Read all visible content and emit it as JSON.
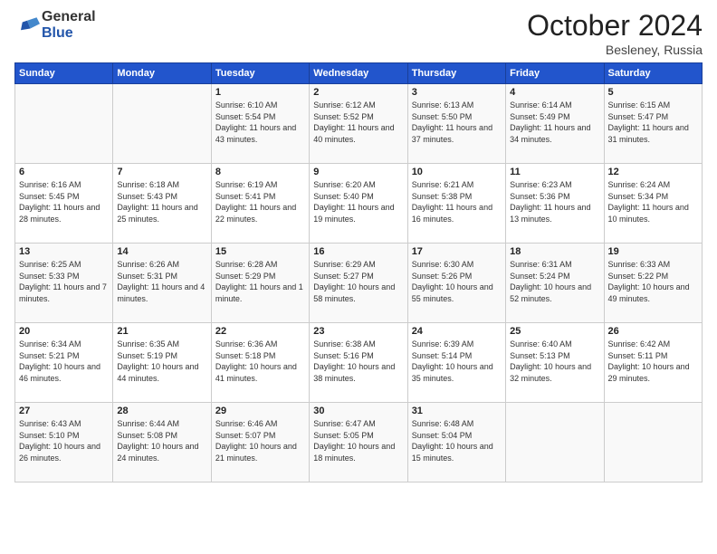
{
  "header": {
    "logo_general": "General",
    "logo_blue": "Blue",
    "month": "October 2024",
    "location": "Besleney, Russia"
  },
  "days_of_week": [
    "Sunday",
    "Monday",
    "Tuesday",
    "Wednesday",
    "Thursday",
    "Friday",
    "Saturday"
  ],
  "weeks": [
    [
      {
        "day": "",
        "sunrise": "",
        "sunset": "",
        "daylight": ""
      },
      {
        "day": "",
        "sunrise": "",
        "sunset": "",
        "daylight": ""
      },
      {
        "day": "1",
        "sunrise": "Sunrise: 6:10 AM",
        "sunset": "Sunset: 5:54 PM",
        "daylight": "Daylight: 11 hours and 43 minutes."
      },
      {
        "day": "2",
        "sunrise": "Sunrise: 6:12 AM",
        "sunset": "Sunset: 5:52 PM",
        "daylight": "Daylight: 11 hours and 40 minutes."
      },
      {
        "day": "3",
        "sunrise": "Sunrise: 6:13 AM",
        "sunset": "Sunset: 5:50 PM",
        "daylight": "Daylight: 11 hours and 37 minutes."
      },
      {
        "day": "4",
        "sunrise": "Sunrise: 6:14 AM",
        "sunset": "Sunset: 5:49 PM",
        "daylight": "Daylight: 11 hours and 34 minutes."
      },
      {
        "day": "5",
        "sunrise": "Sunrise: 6:15 AM",
        "sunset": "Sunset: 5:47 PM",
        "daylight": "Daylight: 11 hours and 31 minutes."
      }
    ],
    [
      {
        "day": "6",
        "sunrise": "Sunrise: 6:16 AM",
        "sunset": "Sunset: 5:45 PM",
        "daylight": "Daylight: 11 hours and 28 minutes."
      },
      {
        "day": "7",
        "sunrise": "Sunrise: 6:18 AM",
        "sunset": "Sunset: 5:43 PM",
        "daylight": "Daylight: 11 hours and 25 minutes."
      },
      {
        "day": "8",
        "sunrise": "Sunrise: 6:19 AM",
        "sunset": "Sunset: 5:41 PM",
        "daylight": "Daylight: 11 hours and 22 minutes."
      },
      {
        "day": "9",
        "sunrise": "Sunrise: 6:20 AM",
        "sunset": "Sunset: 5:40 PM",
        "daylight": "Daylight: 11 hours and 19 minutes."
      },
      {
        "day": "10",
        "sunrise": "Sunrise: 6:21 AM",
        "sunset": "Sunset: 5:38 PM",
        "daylight": "Daylight: 11 hours and 16 minutes."
      },
      {
        "day": "11",
        "sunrise": "Sunrise: 6:23 AM",
        "sunset": "Sunset: 5:36 PM",
        "daylight": "Daylight: 11 hours and 13 minutes."
      },
      {
        "day": "12",
        "sunrise": "Sunrise: 6:24 AM",
        "sunset": "Sunset: 5:34 PM",
        "daylight": "Daylight: 11 hours and 10 minutes."
      }
    ],
    [
      {
        "day": "13",
        "sunrise": "Sunrise: 6:25 AM",
        "sunset": "Sunset: 5:33 PM",
        "daylight": "Daylight: 11 hours and 7 minutes."
      },
      {
        "day": "14",
        "sunrise": "Sunrise: 6:26 AM",
        "sunset": "Sunset: 5:31 PM",
        "daylight": "Daylight: 11 hours and 4 minutes."
      },
      {
        "day": "15",
        "sunrise": "Sunrise: 6:28 AM",
        "sunset": "Sunset: 5:29 PM",
        "daylight": "Daylight: 11 hours and 1 minute."
      },
      {
        "day": "16",
        "sunrise": "Sunrise: 6:29 AM",
        "sunset": "Sunset: 5:27 PM",
        "daylight": "Daylight: 10 hours and 58 minutes."
      },
      {
        "day": "17",
        "sunrise": "Sunrise: 6:30 AM",
        "sunset": "Sunset: 5:26 PM",
        "daylight": "Daylight: 10 hours and 55 minutes."
      },
      {
        "day": "18",
        "sunrise": "Sunrise: 6:31 AM",
        "sunset": "Sunset: 5:24 PM",
        "daylight": "Daylight: 10 hours and 52 minutes."
      },
      {
        "day": "19",
        "sunrise": "Sunrise: 6:33 AM",
        "sunset": "Sunset: 5:22 PM",
        "daylight": "Daylight: 10 hours and 49 minutes."
      }
    ],
    [
      {
        "day": "20",
        "sunrise": "Sunrise: 6:34 AM",
        "sunset": "Sunset: 5:21 PM",
        "daylight": "Daylight: 10 hours and 46 minutes."
      },
      {
        "day": "21",
        "sunrise": "Sunrise: 6:35 AM",
        "sunset": "Sunset: 5:19 PM",
        "daylight": "Daylight: 10 hours and 44 minutes."
      },
      {
        "day": "22",
        "sunrise": "Sunrise: 6:36 AM",
        "sunset": "Sunset: 5:18 PM",
        "daylight": "Daylight: 10 hours and 41 minutes."
      },
      {
        "day": "23",
        "sunrise": "Sunrise: 6:38 AM",
        "sunset": "Sunset: 5:16 PM",
        "daylight": "Daylight: 10 hours and 38 minutes."
      },
      {
        "day": "24",
        "sunrise": "Sunrise: 6:39 AM",
        "sunset": "Sunset: 5:14 PM",
        "daylight": "Daylight: 10 hours and 35 minutes."
      },
      {
        "day": "25",
        "sunrise": "Sunrise: 6:40 AM",
        "sunset": "Sunset: 5:13 PM",
        "daylight": "Daylight: 10 hours and 32 minutes."
      },
      {
        "day": "26",
        "sunrise": "Sunrise: 6:42 AM",
        "sunset": "Sunset: 5:11 PM",
        "daylight": "Daylight: 10 hours and 29 minutes."
      }
    ],
    [
      {
        "day": "27",
        "sunrise": "Sunrise: 6:43 AM",
        "sunset": "Sunset: 5:10 PM",
        "daylight": "Daylight: 10 hours and 26 minutes."
      },
      {
        "day": "28",
        "sunrise": "Sunrise: 6:44 AM",
        "sunset": "Sunset: 5:08 PM",
        "daylight": "Daylight: 10 hours and 24 minutes."
      },
      {
        "day": "29",
        "sunrise": "Sunrise: 6:46 AM",
        "sunset": "Sunset: 5:07 PM",
        "daylight": "Daylight: 10 hours and 21 minutes."
      },
      {
        "day": "30",
        "sunrise": "Sunrise: 6:47 AM",
        "sunset": "Sunset: 5:05 PM",
        "daylight": "Daylight: 10 hours and 18 minutes."
      },
      {
        "day": "31",
        "sunrise": "Sunrise: 6:48 AM",
        "sunset": "Sunset: 5:04 PM",
        "daylight": "Daylight: 10 hours and 15 minutes."
      },
      {
        "day": "",
        "sunrise": "",
        "sunset": "",
        "daylight": ""
      },
      {
        "day": "",
        "sunrise": "",
        "sunset": "",
        "daylight": ""
      }
    ]
  ]
}
